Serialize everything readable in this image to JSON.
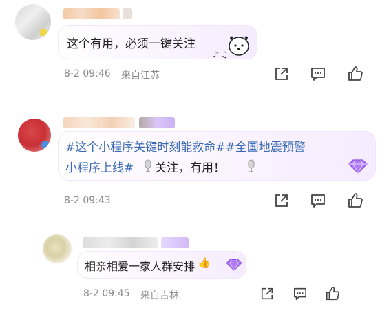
{
  "comments": [
    {
      "text": "这个有用，必须一键关注",
      "date": "8-2 09:46",
      "location": "来自江苏"
    },
    {
      "tags": "#这个小程序关键时刻能救命##全国地震预警",
      "line2_tag": "小程序上线#",
      "text_after": "关注，有用！",
      "date": "8-2 09:43"
    },
    {
      "text": "相亲相爱一家人群安排",
      "date": "8-2 09:45",
      "location": "来自吉林"
    }
  ],
  "colors": {
    "tag": "#3b6bb5",
    "meta": "#8a8a8a",
    "bubble_tint": "#f6ecff",
    "gem": "#9a5cf0"
  },
  "icons": [
    "share-icon",
    "comment-icon",
    "like-icon",
    "mic-icon",
    "gem-icon",
    "thumbs-up-emoji",
    "pochacco-sticker"
  ]
}
